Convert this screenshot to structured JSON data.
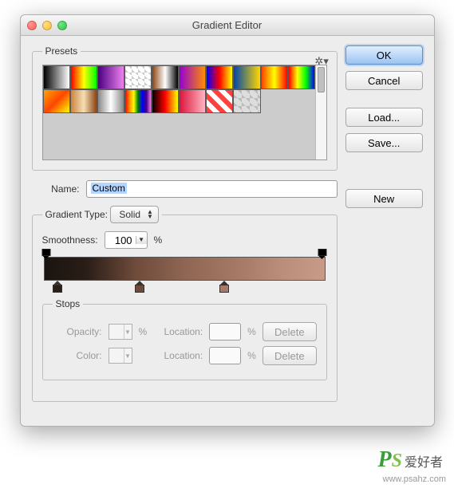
{
  "title": "Gradient Editor",
  "buttons": {
    "ok": "OK",
    "cancel": "Cancel",
    "load": "Load...",
    "save": "Save...",
    "new": "New",
    "delete": "Delete"
  },
  "presets_label": "Presets",
  "name_label": "Name:",
  "name_value": "Custom",
  "gradient_type_label": "Gradient Type:",
  "gradient_type_value": "Solid",
  "smoothness_label": "Smoothness:",
  "smoothness_value": "100",
  "percent": "%",
  "stops_label": "Stops",
  "opacity_label": "Opacity:",
  "location_label": "Location:",
  "color_label": "Color:",
  "preset_swatches": [
    "linear-gradient(90deg,#000,#fff)",
    "linear-gradient(90deg,#ff0000,#ffff00,#00ff00)",
    "linear-gradient(90deg,#4b0082,#ee82ee)",
    "#fff linear-gradient(45deg,#ccc 25%,transparent 25%,transparent 75%,#ccc 75%) 0 0/8px 8px",
    "linear-gradient(90deg,#8b4513,#fff,#000)",
    "linear-gradient(90deg,#9400d3,#ff8c00)",
    "linear-gradient(90deg,#0000ff,#ff0000,#ffff00)",
    "linear-gradient(90deg,#0047ab,#ffd700)",
    "linear-gradient(90deg,#ff4500,#ffff00,#ff0000)",
    "linear-gradient(90deg,#ff0000,#ffff00,#00ff00,#0000ff)",
    "linear-gradient(135deg,#ffa500,#ff4500,#ffff00)",
    "linear-gradient(90deg,#cd853f,#f5deb3,#8b4513)",
    "linear-gradient(90deg,#888,#fff,#888)",
    "linear-gradient(90deg,#ff0000,#ff8c00,#ffff00,#008000,#0000ff,#4b0082,#ee82ee)",
    "linear-gradient(90deg,#000,#ff0000,#ffff00)",
    "linear-gradient(90deg,#dc143c,#ffb6c1)",
    "repeating-linear-gradient(45deg,#ff4040 0 6px,#fff 6px 12px)",
    "#ddd linear-gradient(45deg,#bbb 25%,transparent 25%,transparent 75%,#bbb 75%) 0 0/10px 10px"
  ],
  "gradient_stops": {
    "opacity": [
      0,
      100
    ],
    "color": [
      {
        "pos": 5,
        "color": "#2a1e17"
      },
      {
        "pos": 34,
        "color": "#6d4a3a"
      },
      {
        "pos": 64,
        "color": "#a67a66"
      }
    ]
  },
  "watermark": {
    "logo": "PS",
    "cn": "爱好者",
    "url": "www.psahz.com"
  }
}
